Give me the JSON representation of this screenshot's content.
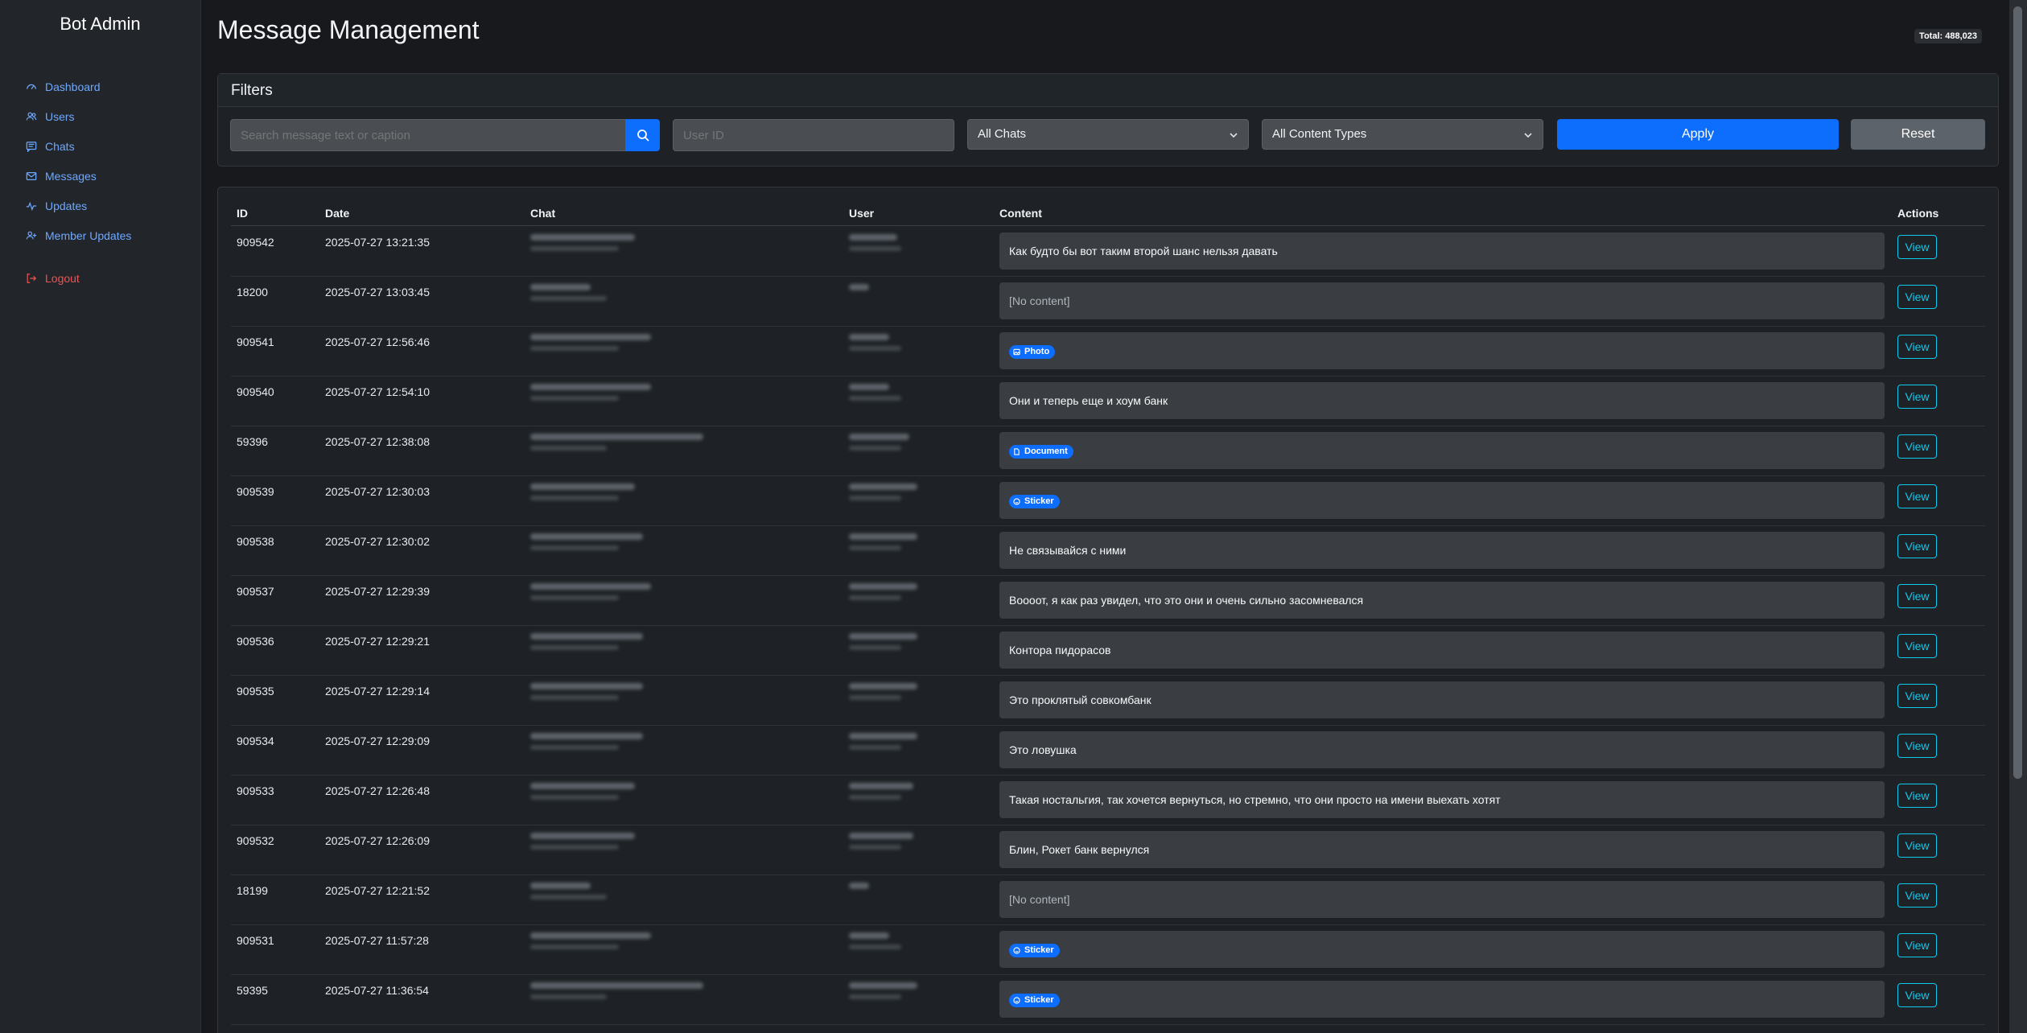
{
  "sidebar": {
    "brand": "Bot Admin",
    "items": [
      {
        "label": "Dashboard",
        "icon": "dashboard-icon"
      },
      {
        "label": "Users",
        "icon": "users-icon"
      },
      {
        "label": "Chats",
        "icon": "chat-icon"
      },
      {
        "label": "Messages",
        "icon": "envelope-icon"
      },
      {
        "label": "Updates",
        "icon": "activity-icon"
      },
      {
        "label": "Member Updates",
        "icon": "person-plus-icon"
      }
    ],
    "logout": "Logout"
  },
  "header": {
    "title": "Message Management",
    "total": "Total: 488,023"
  },
  "filters": {
    "title": "Filters",
    "search_placeholder": "Search message text or caption",
    "userid_placeholder": "User ID",
    "chat_select": "All Chats",
    "type_select": "All Content Types",
    "apply": "Apply",
    "reset": "Reset"
  },
  "table": {
    "columns": {
      "id": "ID",
      "date": "Date",
      "chat": "Chat",
      "user": "User",
      "content": "Content",
      "actions": "Actions"
    },
    "view_label": "View",
    "rows": [
      {
        "id": "909542",
        "date": "2025-07-27 13:21:35",
        "content": "Как будто бы вот таким второй шанс нельзя давать",
        "kind": "text"
      },
      {
        "id": "18200",
        "date": "2025-07-27 13:03:45",
        "content": "[No content]",
        "kind": "empty"
      },
      {
        "id": "909541",
        "date": "2025-07-27 12:56:46",
        "content": "Photo",
        "kind": "badge",
        "icon": "image-icon"
      },
      {
        "id": "909540",
        "date": "2025-07-27 12:54:10",
        "content": "Они и теперь еще и хоум банк",
        "kind": "text"
      },
      {
        "id": "59396",
        "date": "2025-07-27 12:38:08",
        "content": "Document",
        "kind": "badge",
        "icon": "file-icon"
      },
      {
        "id": "909539",
        "date": "2025-07-27 12:30:03",
        "content": "Sticker",
        "kind": "badge",
        "icon": "smile-icon"
      },
      {
        "id": "909538",
        "date": "2025-07-27 12:30:02",
        "content": "Не связывайся с ними",
        "kind": "text"
      },
      {
        "id": "909537",
        "date": "2025-07-27 12:29:39",
        "content": "Воооот, я как раз увидел, что это они и очень сильно засомневался",
        "kind": "text"
      },
      {
        "id": "909536",
        "date": "2025-07-27 12:29:21",
        "content": "Контора пидорасов",
        "kind": "text"
      },
      {
        "id": "909535",
        "date": "2025-07-27 12:29:14",
        "content": "Это проклятый совкомбанк",
        "kind": "text"
      },
      {
        "id": "909534",
        "date": "2025-07-27 12:29:09",
        "content": "Это ловушка",
        "kind": "text"
      },
      {
        "id": "909533",
        "date": "2025-07-27 12:26:48",
        "content": "Такая ностальгия, так хочется вернуться, но стремно, что они просто на имени выехать хотят",
        "kind": "text"
      },
      {
        "id": "909532",
        "date": "2025-07-27 12:26:09",
        "content": "Блин, Рокет банк вернулся",
        "kind": "text"
      },
      {
        "id": "18199",
        "date": "2025-07-27 12:21:52",
        "content": "[No content]",
        "kind": "empty"
      },
      {
        "id": "909531",
        "date": "2025-07-27 11:57:28",
        "content": "Sticker",
        "kind": "badge",
        "icon": "smile-icon"
      },
      {
        "id": "59395",
        "date": "2025-07-27 11:36:54",
        "content": "Sticker",
        "kind": "badge",
        "icon": "smile-icon"
      }
    ]
  },
  "colors": {
    "accent": "#0d6efd",
    "view_outline": "#0dcaf0",
    "logout": "#ea5455",
    "nav_link": "#6ea8fe"
  }
}
